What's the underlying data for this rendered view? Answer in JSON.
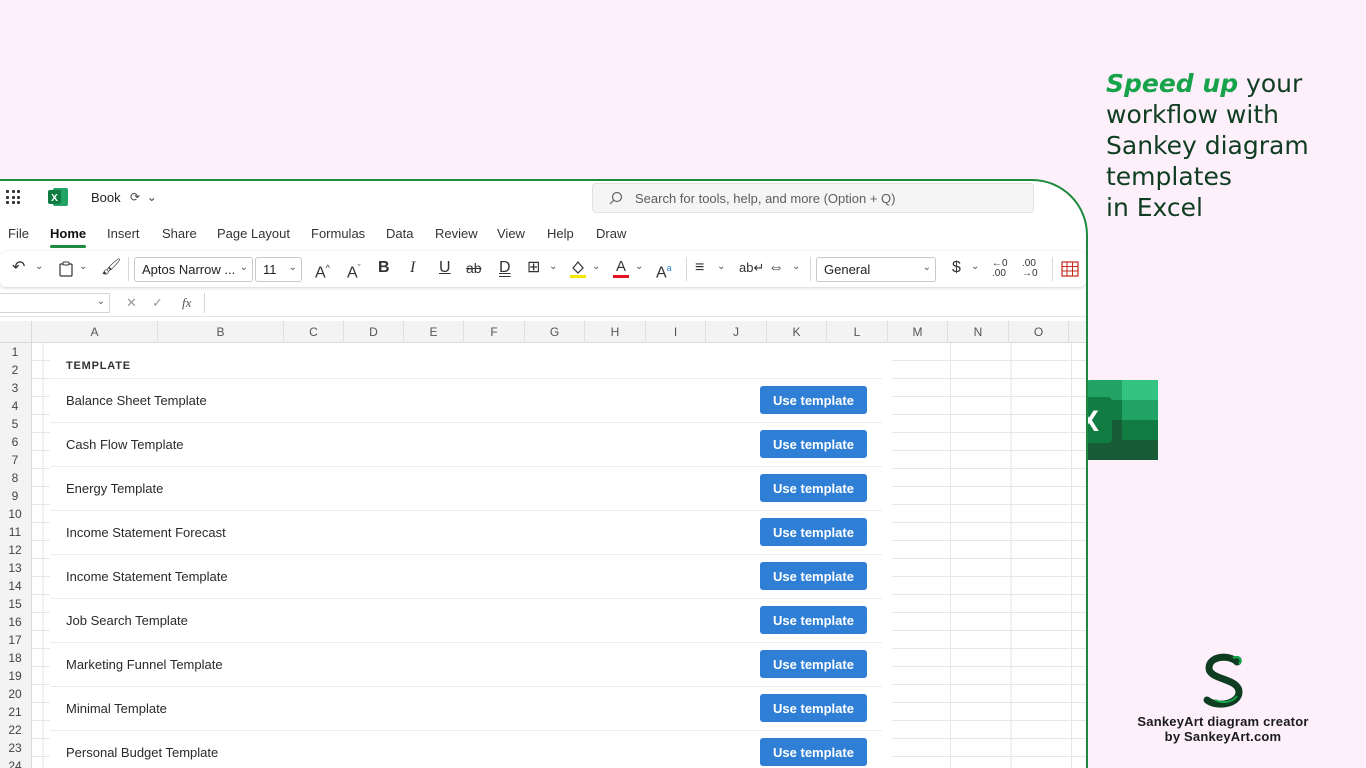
{
  "headline": {
    "accent": "Speed up",
    "rest_line1": " your",
    "line2": "workflow with",
    "line3": "Sankey diagram",
    "line4": "templates",
    "line5": "in Excel"
  },
  "brand": {
    "line1": "SankeyArt diagram creator",
    "line2": "by SankeyArt.com",
    "logo_icon": "sankeyart-s-logo"
  },
  "excel_logo": {
    "letter": "X",
    "icon": "excel-app-logo"
  },
  "titlebar": {
    "app_letter": "X",
    "book_title": "Book",
    "search_placeholder": "Search for tools, help, and more (Option + Q)"
  },
  "menu": [
    "File",
    "Home",
    "Insert",
    "Share",
    "Page Layout",
    "Formulas",
    "Data",
    "Review",
    "View",
    "Help",
    "Draw"
  ],
  "menu_active": "Home",
  "ribbon": {
    "font_name": "Aptos Narrow ...",
    "font_size": "11",
    "number_format": "General",
    "currency": "$",
    "bold": "B",
    "italic": "I",
    "underline": "U",
    "strike": "ab",
    "double_underline": "D"
  },
  "formula_bar": {
    "fx": "fx"
  },
  "columns": [
    "A",
    "B",
    "C",
    "D",
    "E",
    "F",
    "G",
    "H",
    "I",
    "J",
    "K",
    "L",
    "M",
    "N",
    "O"
  ],
  "rows": [
    "1",
    "2",
    "3",
    "4",
    "5",
    "6",
    "7",
    "8",
    "9",
    "10",
    "11",
    "12",
    "13",
    "14",
    "15",
    "16",
    "17",
    "18",
    "19",
    "20",
    "21",
    "22",
    "23",
    "24"
  ],
  "templates": {
    "header": "TEMPLATE",
    "button_label": "Use template",
    "items": [
      "Balance Sheet Template",
      "Cash Flow Template",
      "Energy Template",
      "Income Statement Forecast",
      "Income Statement Template",
      "Job Search Template",
      "Marketing Funnel Template",
      "Minimal Template",
      "Personal Budget Template"
    ]
  },
  "colors": {
    "accent_green": "#17a34a",
    "button_blue": "#2f7fd6",
    "background": "#fdf0fa",
    "window_border": "#1e8a3e"
  }
}
